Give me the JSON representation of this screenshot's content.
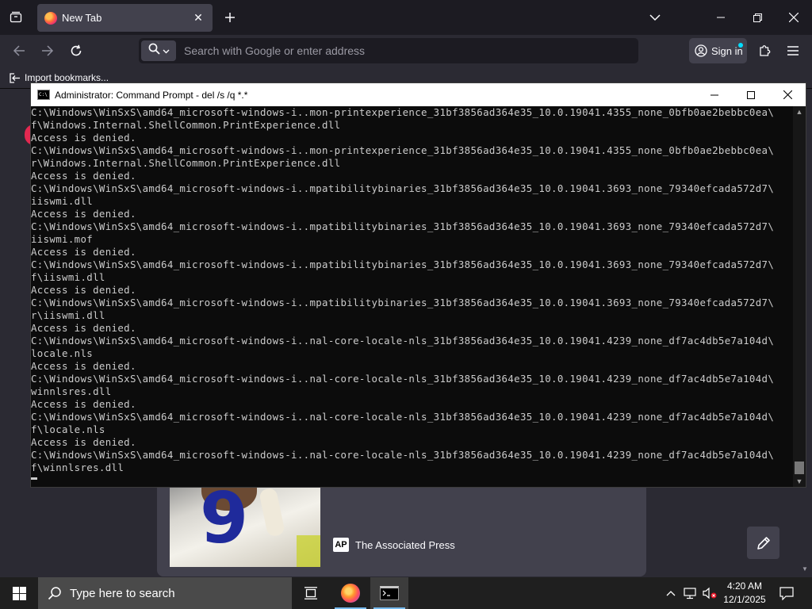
{
  "browser": {
    "tab_title": "New Tab",
    "url_placeholder": "Search with Google or enter address",
    "signin_label": "Sign in",
    "bookmark_import": "Import bookmarks..."
  },
  "newtab": {
    "story_source": "The Associated Press",
    "source_logo": "AP",
    "jersey_number": "9"
  },
  "cmd": {
    "title": "Administrator: Command Prompt - del  /s /q *.*",
    "lines": [
      "C:\\Windows\\WinSxS\\amd64_microsoft-windows-i..mon-printexperience_31bf3856ad364e35_10.0.19041.4355_none_0bfb0ae2bebbc0ea\\",
      "f\\Windows.Internal.ShellCommon.PrintExperience.dll",
      "Access is denied.",
      "C:\\Windows\\WinSxS\\amd64_microsoft-windows-i..mon-printexperience_31bf3856ad364e35_10.0.19041.4355_none_0bfb0ae2bebbc0ea\\",
      "r\\Windows.Internal.ShellCommon.PrintExperience.dll",
      "Access is denied.",
      "C:\\Windows\\WinSxS\\amd64_microsoft-windows-i..mpatibilitybinaries_31bf3856ad364e35_10.0.19041.3693_none_79340efcada572d7\\",
      "iiswmi.dll",
      "Access is denied.",
      "C:\\Windows\\WinSxS\\amd64_microsoft-windows-i..mpatibilitybinaries_31bf3856ad364e35_10.0.19041.3693_none_79340efcada572d7\\",
      "iiswmi.mof",
      "Access is denied.",
      "C:\\Windows\\WinSxS\\amd64_microsoft-windows-i..mpatibilitybinaries_31bf3856ad364e35_10.0.19041.3693_none_79340efcada572d7\\",
      "f\\iiswmi.dll",
      "Access is denied.",
      "C:\\Windows\\WinSxS\\amd64_microsoft-windows-i..mpatibilitybinaries_31bf3856ad364e35_10.0.19041.3693_none_79340efcada572d7\\",
      "r\\iiswmi.dll",
      "Access is denied.",
      "C:\\Windows\\WinSxS\\amd64_microsoft-windows-i..nal-core-locale-nls_31bf3856ad364e35_10.0.19041.4239_none_df7ac4db5e7a104d\\",
      "locale.nls",
      "Access is denied.",
      "C:\\Windows\\WinSxS\\amd64_microsoft-windows-i..nal-core-locale-nls_31bf3856ad364e35_10.0.19041.4239_none_df7ac4db5e7a104d\\",
      "winnlsres.dll",
      "Access is denied.",
      "C:\\Windows\\WinSxS\\amd64_microsoft-windows-i..nal-core-locale-nls_31bf3856ad364e35_10.0.19041.4239_none_df7ac4db5e7a104d\\",
      "f\\locale.nls",
      "Access is denied.",
      "C:\\Windows\\WinSxS\\amd64_microsoft-windows-i..nal-core-locale-nls_31bf3856ad364e35_10.0.19041.4239_none_df7ac4db5e7a104d\\",
      "f\\winnlsres.dll"
    ]
  },
  "taskbar": {
    "search_placeholder": "Type here to search",
    "time": "4:20 AM",
    "date": "12/1/2025"
  },
  "colors": {
    "browser_bg": "#1c1b22",
    "toolbar_bg": "#2b2a33",
    "console_bg": "#0c0c0c",
    "console_text": "#cccccc",
    "taskbar_bg": "#1f1f1f",
    "accent": "#00ddff"
  },
  "icons": [
    "tab-list-icon",
    "firefox-icon",
    "close-icon",
    "plus-icon",
    "chevron-down-icon",
    "minimize-icon",
    "maximize-icon",
    "back-icon",
    "forward-icon",
    "reload-icon",
    "search-icon",
    "account-icon",
    "extensions-icon",
    "menu-icon",
    "import-icon",
    "pencil-icon",
    "windows-start-icon",
    "task-view-icon",
    "cmd-icon",
    "chevron-up-icon",
    "network-icon",
    "volume-muted-icon",
    "notification-icon"
  ]
}
